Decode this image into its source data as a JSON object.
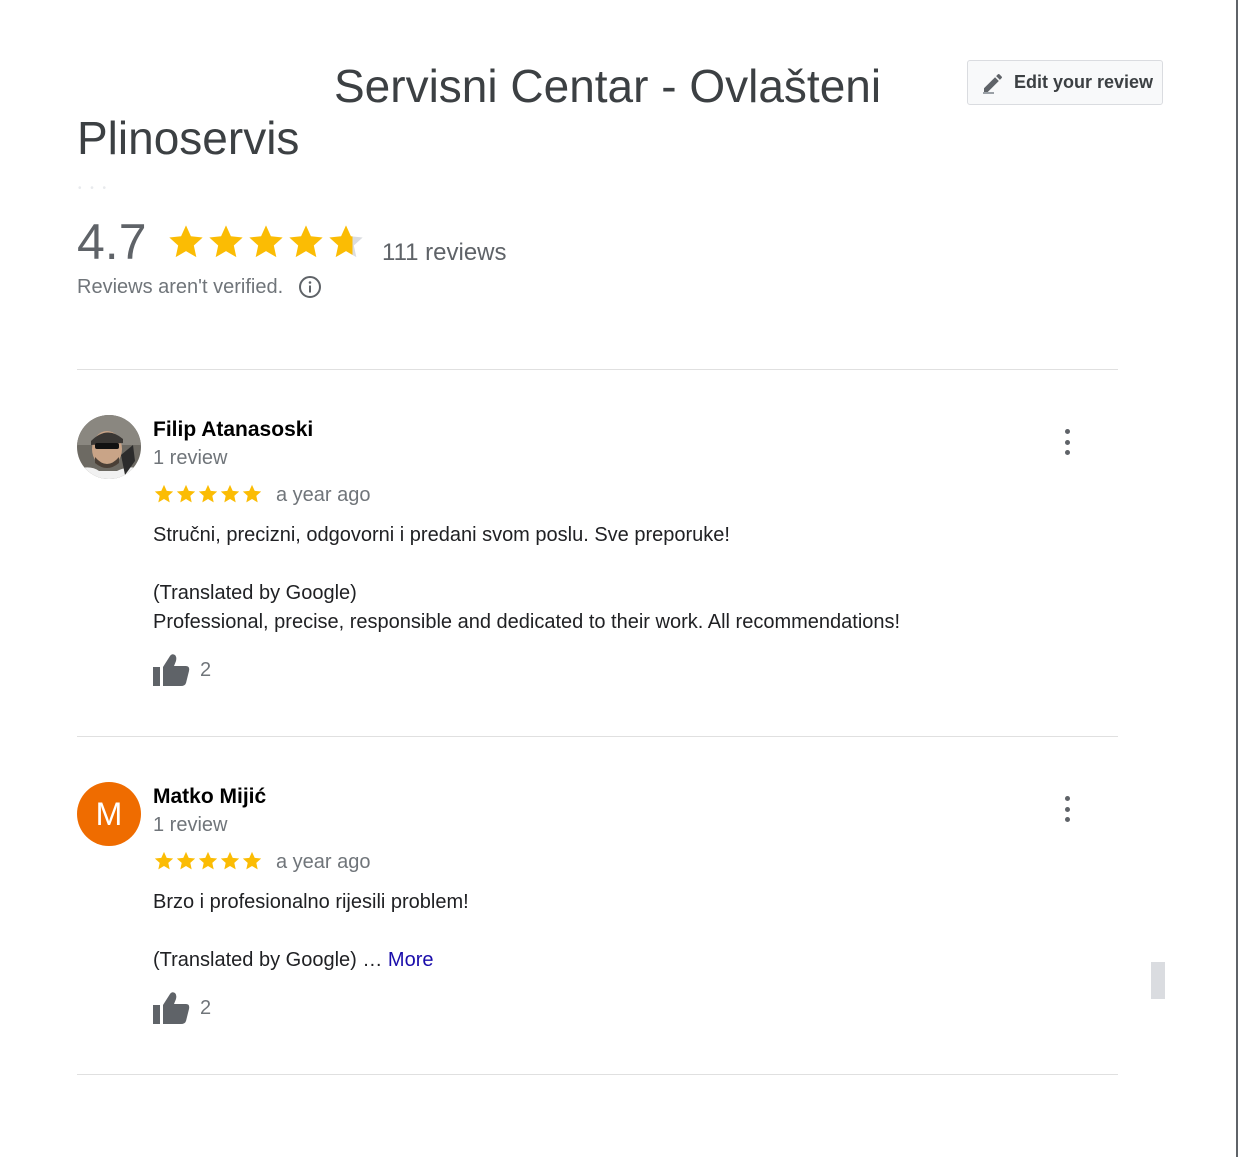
{
  "place": {
    "title_line1": "Servisni Centar - Ovlašteni",
    "title_line2": "Plinoservis"
  },
  "edit_button": {
    "label": "Edit your review",
    "icon": "pencil-icon"
  },
  "summary": {
    "rating": "4.7",
    "rating_value": 4.7,
    "max_stars": 5,
    "review_count": "111 reviews",
    "unverified_note": "Reviews aren't verified.",
    "star_color": "#fbbc04",
    "empty_star_color": "#dadce0"
  },
  "reviews": [
    {
      "author": "Filip Atanasoski",
      "author_reviews": "1 review",
      "stars": 5,
      "time": "a year ago",
      "original_text": "Stručni, precizni, odgovorni i predani svom poslu. Sve preporuke!",
      "translated_label": "(Translated by Google)",
      "translated_text": "Professional, precise, responsible and dedicated to their work. All recommendations!",
      "likes": "2"
    },
    {
      "author": "Matko Mijić",
      "avatar_letter": "M",
      "avatar_color": "#ef6c00",
      "author_reviews": "1 review",
      "stars": 5,
      "time": "a year ago",
      "original_text": "Brzo i profesionalno rijesili problem!",
      "translated_label": "(Translated by Google) …",
      "more_label": "More",
      "likes": "2"
    }
  ]
}
